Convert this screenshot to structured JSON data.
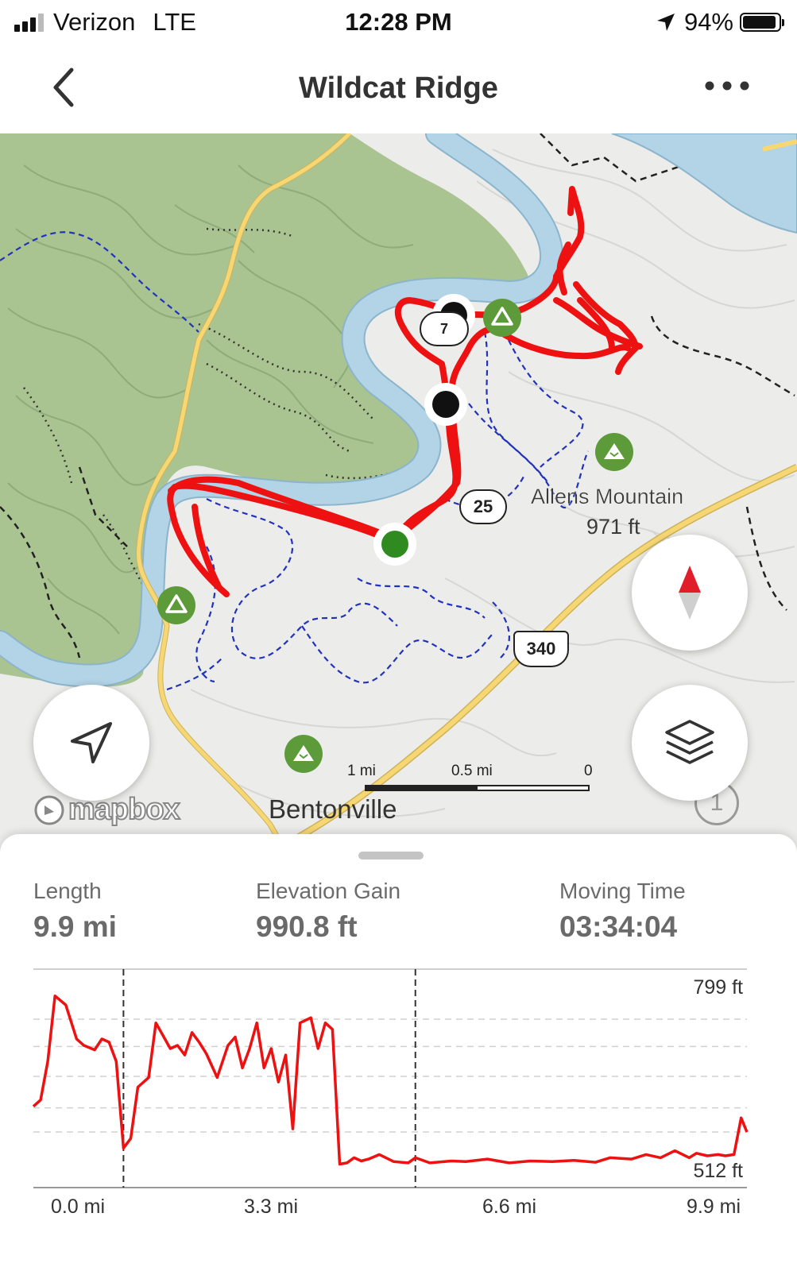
{
  "status_bar": {
    "carrier": "Verizon",
    "network": "LTE",
    "time": "12:28 PM",
    "battery_percent": "94%",
    "battery_level": 0.94,
    "signal_bars": 3
  },
  "nav": {
    "title": "Wildcat Ridge",
    "back_icon": "chevron-left-icon",
    "more_icon": "more-horizontal-icon"
  },
  "map": {
    "labels": {
      "mountain_name": "Allens Mountain",
      "mountain_elevation": "971 ft",
      "town": "Bentonville",
      "route_340": "340",
      "route_25": "25",
      "route_partial": "7"
    },
    "scale": {
      "left": "1 mi",
      "mid": "0.5 mi",
      "right": "0"
    },
    "attribution": "mapbox",
    "info_count": "1",
    "colors": {
      "track": "#ee1111",
      "river": "#b3d3e6",
      "forest": "#a9c391",
      "road": "#f7d774",
      "trail": "#2233bb",
      "campsite": "#5c9a3a"
    },
    "buttons": {
      "locate_icon": "navigation-arrow-icon",
      "compass_icon": "compass-icon",
      "layers_icon": "layers-icon"
    }
  },
  "stats": {
    "length": {
      "label": "Length",
      "value": "9.9 mi"
    },
    "elevation_gain": {
      "label": "Elevation Gain",
      "value": "990.8 ft"
    },
    "moving_time": {
      "label": "Moving Time",
      "value": "03:34:04"
    }
  },
  "chart_data": {
    "type": "line",
    "title": "",
    "xlabel": "",
    "ylabel": "",
    "x_tick_labels": [
      "0.0 mi",
      "3.3 mi",
      "6.6 mi",
      "9.9 mi"
    ],
    "y_tick_labels": [
      "799 ft",
      "512 ft"
    ],
    "xlim": [
      0,
      9.9
    ],
    "ylim": [
      512,
      799
    ],
    "markers_x": [
      1.25,
      5.3
    ],
    "series": [
      {
        "color": "#ee1111",
        "x": [
          0.0,
          0.1,
          0.2,
          0.3,
          0.45,
          0.6,
          0.7,
          0.85,
          0.95,
          1.05,
          1.15,
          1.25,
          1.35,
          1.45,
          1.6,
          1.7,
          1.8,
          1.9,
          2.0,
          2.1,
          2.2,
          2.3,
          2.4,
          2.55,
          2.7,
          2.8,
          2.9,
          3.0,
          3.1,
          3.2,
          3.3,
          3.4,
          3.5,
          3.6,
          3.7,
          3.85,
          3.95,
          4.05,
          4.15,
          4.25,
          4.35,
          4.45,
          4.55,
          4.65,
          4.8,
          5.0,
          5.2,
          5.3,
          5.5,
          5.8,
          6.0,
          6.3,
          6.6,
          6.9,
          7.2,
          7.5,
          7.8,
          8.0,
          8.3,
          8.5,
          8.7,
          8.9,
          9.1,
          9.2,
          9.35,
          9.5,
          9.6,
          9.72,
          9.82,
          9.9
        ],
        "y": [
          610,
          620,
          680,
          782,
          768,
          715,
          705,
          698,
          715,
          710,
          680,
          545,
          560,
          640,
          655,
          740,
          720,
          700,
          705,
          690,
          725,
          710,
          692,
          655,
          705,
          718,
          670,
          700,
          740,
          670,
          700,
          648,
          690,
          575,
          740,
          748,
          700,
          740,
          730,
          520,
          522,
          530,
          525,
          528,
          535,
          524,
          522,
          530,
          522,
          525,
          524,
          528,
          522,
          525,
          524,
          526,
          523,
          530,
          528,
          535,
          530,
          541,
          530,
          537,
          533,
          535,
          533,
          535,
          592,
          570
        ]
      }
    ]
  }
}
